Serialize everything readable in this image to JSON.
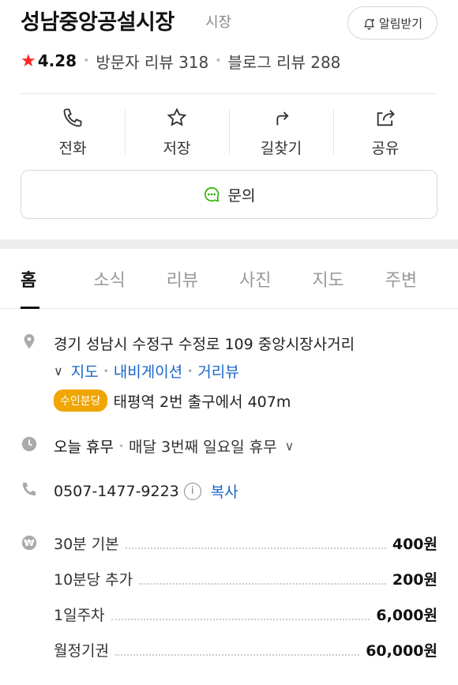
{
  "place": {
    "name": "성남중앙공설시장",
    "category": "시장",
    "alarm_label": "알림받기"
  },
  "rating": {
    "score": "4.28",
    "visitor_reviews": "방문자 리뷰 318",
    "blog_reviews": "블로그 리뷰 288"
  },
  "actions": [
    {
      "label": "전화",
      "icon": "phone-icon"
    },
    {
      "label": "저장",
      "icon": "star-icon"
    },
    {
      "label": "길찾기",
      "icon": "directions-icon"
    },
    {
      "label": "공유",
      "icon": "share-icon"
    }
  ],
  "inquiry_label": "문의",
  "tabs": [
    "홈",
    "소식",
    "리뷰",
    "사진",
    "지도",
    "주변"
  ],
  "address": {
    "text": "경기 성남시 수정구 수정로 109 중앙시장사거리",
    "links": [
      "지도",
      "내비게이션",
      "거리뷰"
    ]
  },
  "subway": {
    "line_badge": "수인분당",
    "text": "태평역 2번 출구에서 407m"
  },
  "hours": {
    "status": "오늘 휴무",
    "detail": "매달 3번째 일요일 휴무"
  },
  "phone": {
    "number": "0507-1477-9223",
    "copy_label": "복사"
  },
  "prices": [
    {
      "label": "30분 기본",
      "value": "400원"
    },
    {
      "label": "10분당 추가",
      "value": "200원"
    },
    {
      "label": "1일주차",
      "value": "6,000원"
    },
    {
      "label": "월정기권",
      "value": "60,000원"
    }
  ],
  "colors": {
    "link": "#1b66c9",
    "star": "#ff2222",
    "badge": "#f0a500",
    "inquiry_icon": "#2db400"
  }
}
